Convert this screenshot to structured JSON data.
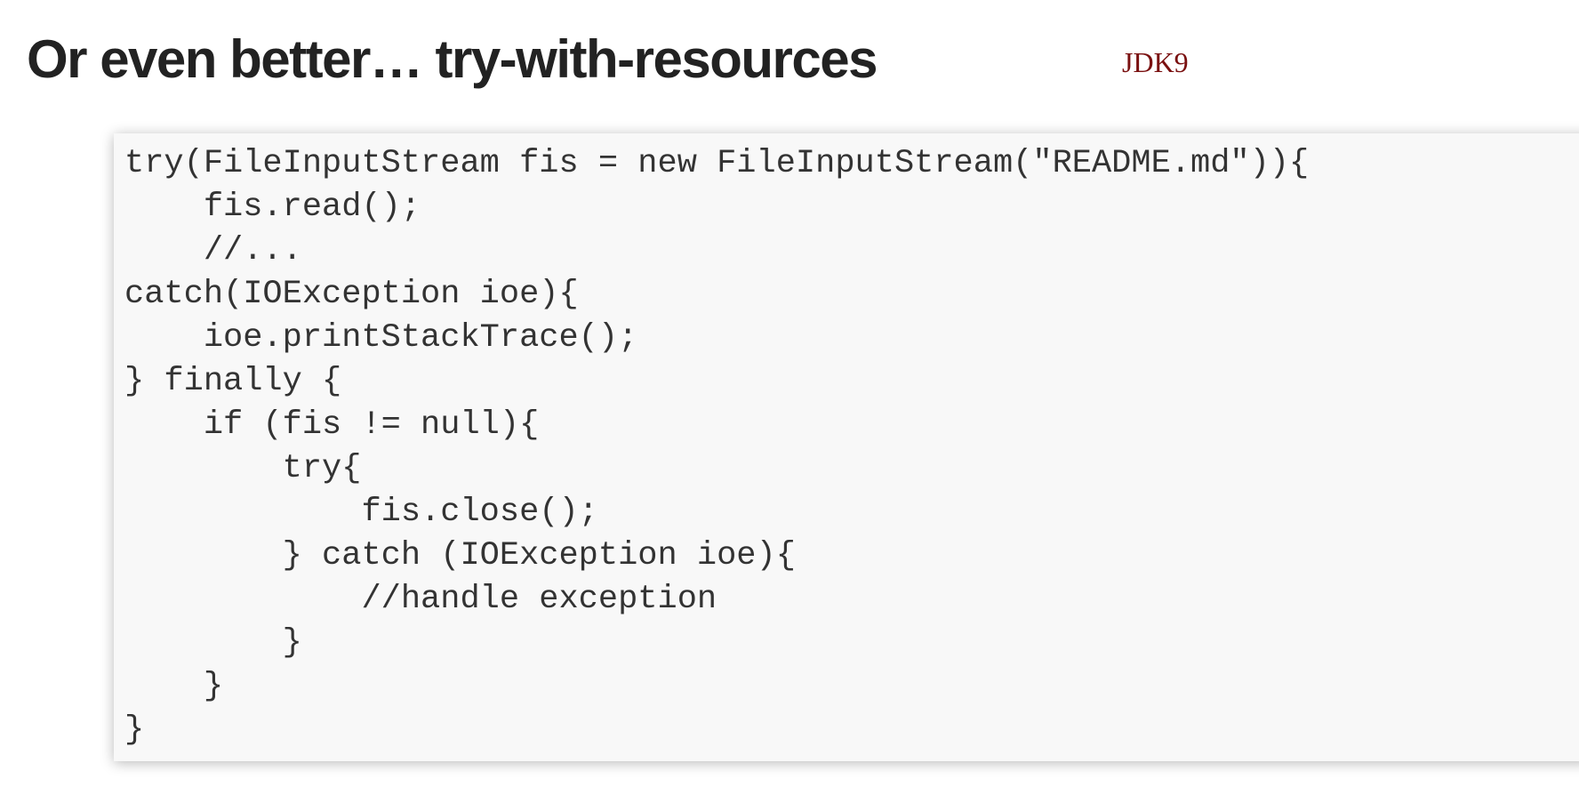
{
  "slide": {
    "title": "Or even better… try-with-resources",
    "badge": "JDK9",
    "code_lines": [
      "try(FileInputStream fis = new FileInputStream(\"README.md\")){",
      "    fis.read();",
      "    //...",
      "catch(IOException ioe){",
      "    ioe.printStackTrace();",
      "} finally {",
      "    if (fis != null){",
      "        try{",
      "            fis.close();",
      "        } catch (IOException ioe){",
      "            //handle exception",
      "        }",
      "    }",
      "}"
    ]
  }
}
